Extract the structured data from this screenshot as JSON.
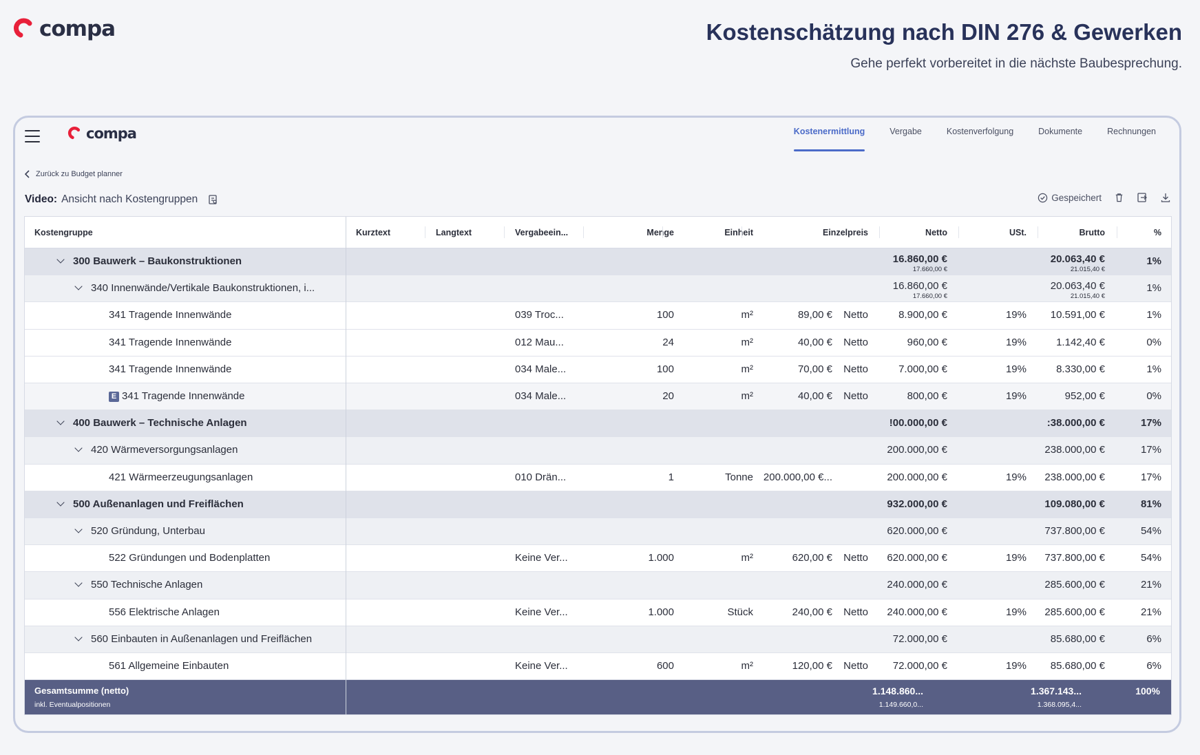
{
  "brand": {
    "name": "compa",
    "accent": "#e8203a"
  },
  "hero": {
    "title": "Kostenschätzung nach DIN 276 & Gewerken",
    "subtitle": "Gehe perfekt vorbereitet in die nächste Baubesprechung."
  },
  "nav": {
    "tabs": [
      "Kostenermittlung",
      "Vergabe",
      "Kostenverfolgung",
      "Dokumente",
      "Rechnungen"
    ],
    "active_tab": "Kostenermittlung"
  },
  "back_link": "Zurück zu Budget planner",
  "view": {
    "label": "Video:",
    "name": "Ansicht nach Kostengruppen"
  },
  "toolbar": {
    "saved_label": "Gespeichert"
  },
  "table": {
    "columns": [
      "Kostengruppe",
      "Kurztext",
      "Langtext",
      "Vergabeein...",
      "Menge",
      "Einheit",
      "Einzelpreis",
      "Netto",
      "USt.",
      "Brutto",
      "%"
    ],
    "rows": [
      {
        "level": 1,
        "name": "300 Bauwerk – Baukonstruktionen",
        "vergabe": "",
        "menge": "",
        "einheit": "",
        "einzelpreis": "",
        "preistyp": "",
        "netto": "16.860,00 €",
        "netto_sub": "17.660,00 €",
        "ust": "",
        "brutto": "20.063,40 €",
        "brutto_sub": "21.015,40 €",
        "pct": "1%"
      },
      {
        "level": 2,
        "name": "340 Innenwände/Vertikale Baukonstruktionen, i...",
        "vergabe": "",
        "menge": "",
        "einheit": "",
        "einzelpreis": "",
        "preistyp": "",
        "netto": "16.860,00 €",
        "netto_sub": "17.660,00 €",
        "ust": "",
        "brutto": "20.063,40 €",
        "brutto_sub": "21.015,40 €",
        "pct": "1%"
      },
      {
        "level": 3,
        "name": "341 Tragende Innenwände",
        "vergabe": "039 Troc...",
        "menge": "100",
        "einheit": "m²",
        "einzelpreis": "89,00 €",
        "preistyp": "Netto",
        "netto": "8.900,00 €",
        "netto_sub": "",
        "ust": "19%",
        "brutto": "10.591,00 €",
        "brutto_sub": "",
        "pct": "1%"
      },
      {
        "level": 3,
        "name": "341 Tragende Innenwände",
        "vergabe": "012 Mau...",
        "menge": "24",
        "einheit": "m²",
        "einzelpreis": "40,00 €",
        "preistyp": "Netto",
        "netto": "960,00 €",
        "netto_sub": "",
        "ust": "19%",
        "brutto": "1.142,40 €",
        "brutto_sub": "",
        "pct": "0%"
      },
      {
        "level": 3,
        "name": "341 Tragende Innenwände",
        "vergabe": "034 Male...",
        "menge": "100",
        "einheit": "m²",
        "einzelpreis": "70,00 €",
        "preistyp": "Netto",
        "netto": "7.000,00 €",
        "netto_sub": "",
        "ust": "19%",
        "brutto": "8.330,00 €",
        "brutto_sub": "",
        "pct": "1%"
      },
      {
        "level": 3,
        "badge": "E",
        "name": "341 Tragende Innenwände",
        "vergabe": "034 Male...",
        "menge": "20",
        "einheit": "m²",
        "einzelpreis": "40,00 €",
        "preistyp": "Netto",
        "netto": "800,00 €",
        "netto_sub": "",
        "ust": "19%",
        "brutto": "952,00 €",
        "brutto_sub": "",
        "pct": "0%"
      },
      {
        "level": 1,
        "name": "400 Bauwerk – Technische Anlagen",
        "vergabe": "",
        "menge": "",
        "einheit": "",
        "einzelpreis": "",
        "preistyp": "",
        "netto": "!00.000,00 €",
        "netto_sub": "",
        "ust": "",
        "brutto": ":38.000,00 €",
        "brutto_sub": "",
        "pct": "17%"
      },
      {
        "level": 2,
        "name": "420 Wärmeversorgungsanlagen",
        "vergabe": "",
        "menge": "",
        "einheit": "",
        "einzelpreis": "",
        "preistyp": "",
        "netto": "200.000,00 €",
        "netto_sub": "",
        "ust": "",
        "brutto": "238.000,00 €",
        "brutto_sub": "",
        "pct": "17%"
      },
      {
        "level": 3,
        "name": "421 Wärmeerzeugungsanlagen",
        "vergabe": "010 Drän...",
        "menge": "1",
        "einheit": "Tonne",
        "einzelpreis": "200.000,00 €...",
        "preistyp": "",
        "netto": "200.000,00 €",
        "netto_sub": "",
        "ust": "19%",
        "brutto": "238.000,00 €",
        "brutto_sub": "",
        "pct": "17%"
      },
      {
        "level": 1,
        "name": "500 Außenanlagen und Freiflächen",
        "vergabe": "",
        "menge": "",
        "einheit": "",
        "einzelpreis": "",
        "preistyp": "",
        "netto": "932.000,00 €",
        "netto_sub": "",
        "ust": "",
        "brutto": "109.080,00 €",
        "brutto_sub": "",
        "pct": "81%"
      },
      {
        "level": 2,
        "name": "520 Gründung, Unterbau",
        "vergabe": "",
        "menge": "",
        "einheit": "",
        "einzelpreis": "",
        "preistyp": "",
        "netto": "620.000,00 €",
        "netto_sub": "",
        "ust": "",
        "brutto": "737.800,00 €",
        "brutto_sub": "",
        "pct": "54%"
      },
      {
        "level": 3,
        "name": "522 Gründungen und Bodenplatten",
        "vergabe": "Keine Ver...",
        "menge": "1.000",
        "einheit": "m²",
        "einzelpreis": "620,00 €",
        "preistyp": "Netto",
        "netto": "620.000,00 €",
        "netto_sub": "",
        "ust": "19%",
        "brutto": "737.800,00 €",
        "brutto_sub": "",
        "pct": "54%"
      },
      {
        "level": 2,
        "name": "550 Technische Anlagen",
        "vergabe": "",
        "menge": "",
        "einheit": "",
        "einzelpreis": "",
        "preistyp": "",
        "netto": "240.000,00 €",
        "netto_sub": "",
        "ust": "",
        "brutto": "285.600,00 €",
        "brutto_sub": "",
        "pct": "21%"
      },
      {
        "level": 3,
        "name": "556 Elektrische Anlagen",
        "vergabe": "Keine Ver...",
        "menge": "1.000",
        "einheit": "Stück",
        "einzelpreis": "240,00 €",
        "preistyp": "Netto",
        "netto": "240.000,00 €",
        "netto_sub": "",
        "ust": "19%",
        "brutto": "285.600,00 €",
        "brutto_sub": "",
        "pct": "21%"
      },
      {
        "level": 2,
        "name": "560 Einbauten in Außenanlagen und Freiflächen",
        "vergabe": "",
        "menge": "",
        "einheit": "",
        "einzelpreis": "",
        "preistyp": "",
        "netto": "72.000,00 €",
        "netto_sub": "",
        "ust": "",
        "brutto": "85.680,00 €",
        "brutto_sub": "",
        "pct": "6%"
      },
      {
        "level": 3,
        "name": "561 Allgemeine Einbauten",
        "vergabe": "Keine Ver...",
        "menge": "600",
        "einheit": "m²",
        "einzelpreis": "120,00 €",
        "preistyp": "Netto",
        "netto": "72.000,00 €",
        "netto_sub": "",
        "ust": "19%",
        "brutto": "85.680,00 €",
        "brutto_sub": "",
        "pct": "6%"
      }
    ],
    "total": {
      "label": "Gesamtsumme (netto)",
      "sublabel": "inkl. Eventualpositionen",
      "netto": "1.148.860...",
      "netto_sub": "1.149.660,0...",
      "brutto": "1.367.143...",
      "brutto_sub": "1.368.095,4...",
      "pct": "100%"
    }
  }
}
